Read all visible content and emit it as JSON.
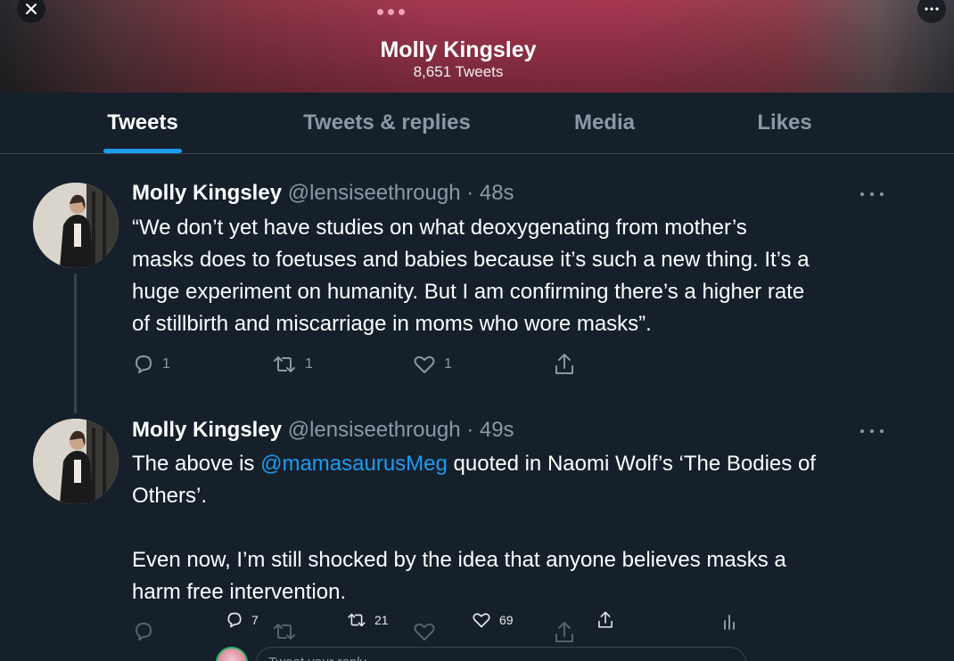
{
  "header": {
    "name": "Molly Kingsley",
    "tweet_count": "8,651 Tweets"
  },
  "tabs": [
    {
      "label": "Tweets",
      "active": true
    },
    {
      "label": "Tweets & replies",
      "active": false
    },
    {
      "label": "Media",
      "active": false
    },
    {
      "label": "Likes",
      "active": false
    }
  ],
  "tweets": [
    {
      "name": "Molly Kingsley",
      "meta": "@lensiseethrough · 48s",
      "lines": [
        "“We don’t yet have studies on what deoxygenating from mother’s",
        "masks does to foetuses and babies because it’s such a new thing. It’s a",
        "huge experiment on humanity. But I am confirming there’s a higher rate",
        "of stillbirth and miscarriage in moms who wore masks”."
      ],
      "replies": "1",
      "retweets": "1",
      "likes": "1"
    },
    {
      "name": "Molly Kingsley",
      "meta": "@lensiseethrough · 49s",
      "line1_before": "The above is ",
      "mention": "@mamasaurusMeg",
      "line1_after": " quoted in Naomi Wolf’s ‘The Bodies of",
      "line2": "Others’.",
      "line3": "Even now, I’m still shocked by the idea that anyone believes masks a",
      "line4": "harm free intervention.",
      "replies": "7",
      "retweets": "21",
      "likes": "69"
    }
  ],
  "reply_bar": {
    "placeholder": "Tweet your reply"
  },
  "colors": {
    "background": "#15202b",
    "accent": "#1d9bf0",
    "muted": "#8b98a5",
    "divider": "#38444d"
  },
  "icons": [
    "close-icon",
    "more-icon",
    "reply-icon",
    "retweet-icon",
    "like-icon",
    "share-icon",
    "analytics-icon"
  ]
}
